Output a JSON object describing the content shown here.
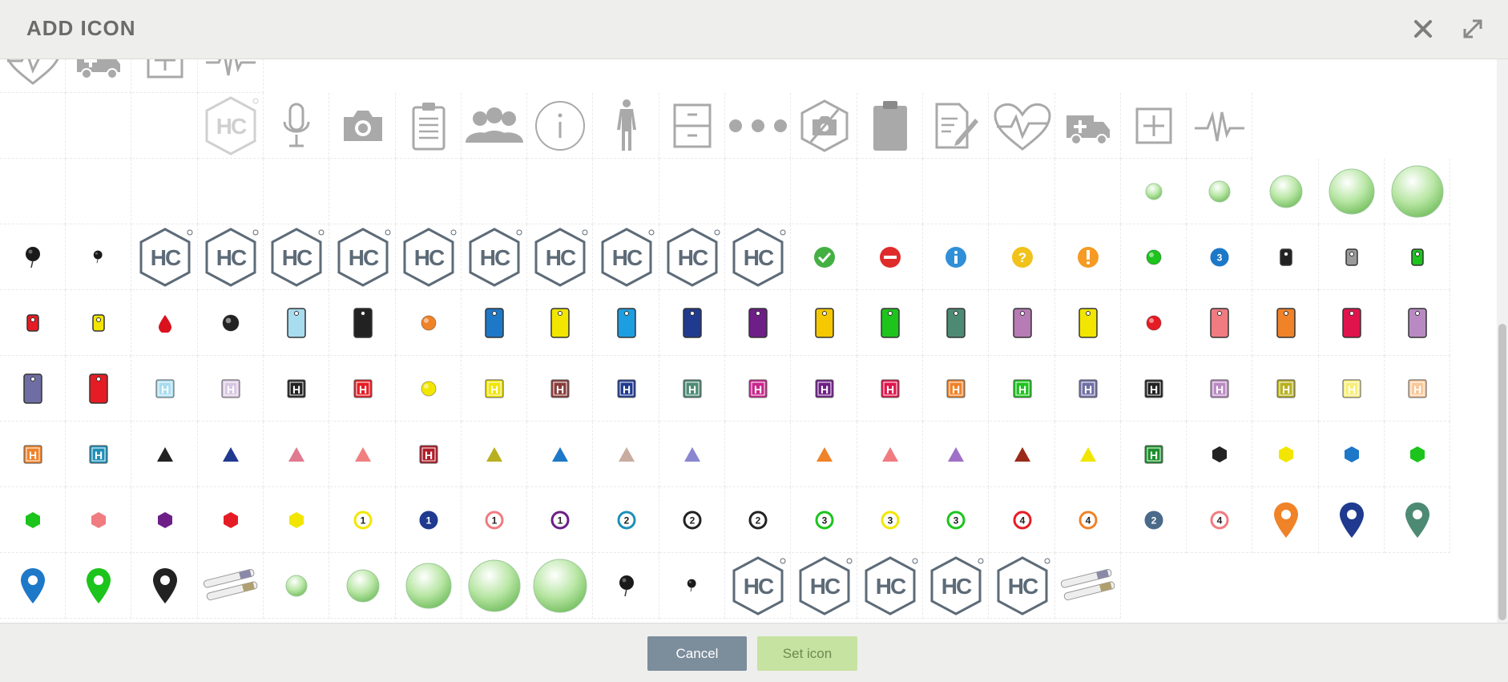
{
  "dialog": {
    "title": "ADD ICON",
    "close_label": "×",
    "expand_label": "⤢"
  },
  "footer": {
    "cancel_label": "Cancel",
    "set_icon_label": "Set icon"
  },
  "hc_badge_text": "HC",
  "colors": {
    "header_bg": "#eeeeec",
    "cancel_bg": "#7c8d9c",
    "set_icon_bg": "#c6e3a1",
    "hc_gray": "#5d6b78",
    "icon_gray": "#a9a9a9"
  },
  "rows": [
    [
      "heart-pulse-gray",
      "ambulance-gray",
      "plus-box-gray",
      "pulse-line-gray"
    ],
    [
      "",
      "",
      "",
      "hc-badge-light",
      "microphone-gray",
      "camera-gray",
      "clipboard-gray",
      "group-gray",
      "info-circle-gray",
      "human-body-gray",
      "cabinet-gray",
      "dots-gray",
      "no-camera-gray",
      "clipboard-solid-gray",
      "edit-document-gray",
      "heart-pulse-gray",
      "ambulance-gray",
      "plus-box-gray",
      "pulse-line-gray"
    ],
    [
      "",
      "",
      "",
      "",
      "",
      "",
      "",
      "",
      "",
      "",
      "",
      "",
      "",
      "",
      "",
      "",
      "",
      "green-orb-xs",
      "green-orb-s",
      "green-orb-m",
      "green-orb-l",
      "green-orb-xl"
    ],
    [
      "pushpin-black",
      "pushpin-black-small",
      "hc-badge",
      "hc-badge",
      "hc-badge",
      "hc-badge",
      "hc-badge",
      "hc-badge",
      "hc-badge",
      "hc-badge",
      "hc-badge",
      "hc-badge",
      "check-green",
      "minus-red",
      "info-blue",
      "question-yellow",
      "exclamation-orange",
      "dot-green",
      "number-3-blue",
      "tag-black-small",
      "tag-gray-small",
      "tag-green-small"
    ],
    [
      "tag-red-small",
      "tag-yellow-small",
      "drop-red",
      "dot-black",
      "tag-lightblue",
      "tag-black",
      "dot-orange",
      "tag-blue",
      "tag-yellow",
      "tag-skyblue",
      "tag-navy",
      "tag-purple",
      "tag-gold",
      "tag-green",
      "tag-teal",
      "tag-lilac",
      "tag-yellow-b",
      "dot-red",
      "tag-pink",
      "tag-orange",
      "tag-crimson",
      "tag-mauve"
    ],
    [
      "tag-slate",
      "tag-red",
      "h-square-lightblue",
      "h-square-lavender",
      "h-square-black",
      "h-square-red",
      "dot-yellow",
      "h-square-yellow",
      "h-square-brown",
      "h-square-navy",
      "h-square-teal",
      "h-square-magenta",
      "h-square-purple",
      "h-square-crimson",
      "h-square-orange",
      "h-square-green",
      "h-square-slate",
      "h-square-black-b",
      "h-square-mauve",
      "h-square-olive",
      "h-square-lightyellow",
      "h-square-peach"
    ],
    [
      "h-square-orange-b",
      "h-square-cyan",
      "triangle-black",
      "triangle-navy",
      "triangle-rose",
      "triangle-salmon",
      "h-square-darkred",
      "triangle-olive",
      "triangle-blue",
      "triangle-beige",
      "triangle-periwinkle",
      "",
      "triangle-orange",
      "triangle-pink",
      "triangle-violet",
      "triangle-maroon",
      "triangle-yellow",
      "h-square-darkgreen",
      "hexagon-black",
      "hexagon-yellow",
      "hexagon-blue",
      "hexagon-green"
    ],
    [
      "hexagon-green",
      "hexagon-pink",
      "hexagon-purple",
      "hexagon-red",
      "hexagon-yellow",
      "number-1-yellow",
      "number-1-navy",
      "number-1-pink",
      "number-1-purple",
      "number-2-cyan",
      "number-2-black",
      "number-2-black",
      "number-3-green",
      "number-3-yellow",
      "number-3-green",
      "number-4-red",
      "number-4-orange",
      "number-2-steel",
      "number-4-pink",
      "map-pin-orange",
      "map-pin-navy",
      "map-pin-teal"
    ],
    [
      "map-pin-blue",
      "map-pin-green",
      "map-pin-black",
      "test-tubes",
      "green-orb-s",
      "green-orb-m",
      "green-orb-l",
      "green-orb-xl",
      "green-orb-xxl",
      "pushpin-black",
      "pushpin-black-small",
      "hc-badge",
      "hc-badge",
      "hc-badge",
      "hc-badge",
      "hc-badge",
      "test-tubes"
    ]
  ]
}
